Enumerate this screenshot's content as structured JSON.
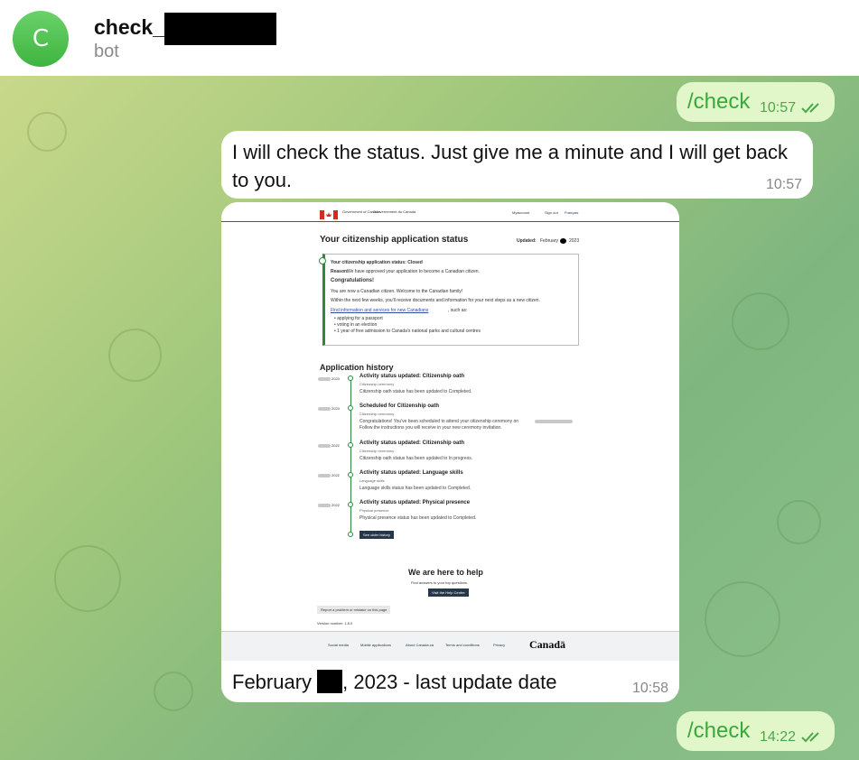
{
  "header": {
    "avatar_letter": "C",
    "title": "check_",
    "subtitle": "bot"
  },
  "messages": {
    "out1": {
      "text": "/check",
      "time": "10:57"
    },
    "in1": {
      "text": "I will check the status. Just give me a minute and I will get back to you.",
      "time": "10:57"
    },
    "in2": {
      "caption_pre": "February ",
      "caption_post": ", 2023 - last update date",
      "time": "10:58"
    },
    "out2": {
      "text": "/check",
      "time": "14:22"
    }
  },
  "screenshot": {
    "gov_en": "Government of Canada",
    "gov_fr": "Gouvernement du Canada",
    "nav": [
      "Myaccount",
      "Sign out",
      "Français"
    ],
    "page_title": "Your citizenship application status",
    "updated_label": "Updated:",
    "updated_value": "February",
    "updated_year": "2023",
    "status_heading": "Your citizenship application status: Closed",
    "reason_label": "Reason:",
    "reason_text": "We have approved your application to become a Canadian citizen.",
    "congrats": "Congratulations!",
    "congrats_p1": "You are now a Canadian citizen. Welcome to the Canadian family!",
    "congrats_p2": "Within the next few weeks, you'll receive documents and information for your next steps as a new citizen.",
    "link": "Find information and services for new Canadians",
    "link_suffix": ", such as:",
    "bullets": [
      "applying for a passport",
      "voting in an election",
      "1 year of free admission to Canada's national parks and cultural centres"
    ],
    "history_title": "Application history",
    "history": [
      {
        "date": "2023",
        "title": "Activity status updated: Citizenship oath",
        "sub": "Citizenship ceremony",
        "desc": "Citizenship oath status has been updated to Completed."
      },
      {
        "date": "2023",
        "title": "Scheduled for Citizenship oath",
        "sub": "Citizenship ceremony",
        "desc": "Congratulations! You've been scheduled to attend your citizenship ceremony on",
        "desc2": "Follow the instructions you will receive in your new ceremony invitation."
      },
      {
        "date": "2022",
        "title": "Activity status updated: Citizenship oath",
        "sub": "Citizenship ceremony",
        "desc": "Citizenship oath status has been updated to In progress."
      },
      {
        "date": "2022",
        "title": "Activity status updated: Language skills",
        "sub": "Language skills",
        "desc": "Language skills status has been updated to Completed."
      },
      {
        "date": "2022",
        "title": "Activity status updated: Physical presence",
        "sub": "Physical presence",
        "desc": "Physical presence status has been updated to Completed."
      }
    ],
    "see_older": "See older history",
    "help_title": "We are here to help",
    "help_sub": "Find answers to your top questions.",
    "help_btn": "Visit the Help Centre",
    "report": "Report a problem or mistake on this page",
    "version": "Version number: 1.8.0",
    "footer_links": [
      "Social media",
      "Mobile applications",
      "About Canada.ca",
      "Terms and conditions",
      "Privacy"
    ],
    "wordmark": "Canadä"
  },
  "colors": {
    "outgoing_bubble": "#e1f7c9",
    "outgoing_text": "#3aa83a",
    "incoming_bubble": "#ffffff",
    "canada_red": "#d52b1e",
    "status_green": "#2b8a3e"
  }
}
